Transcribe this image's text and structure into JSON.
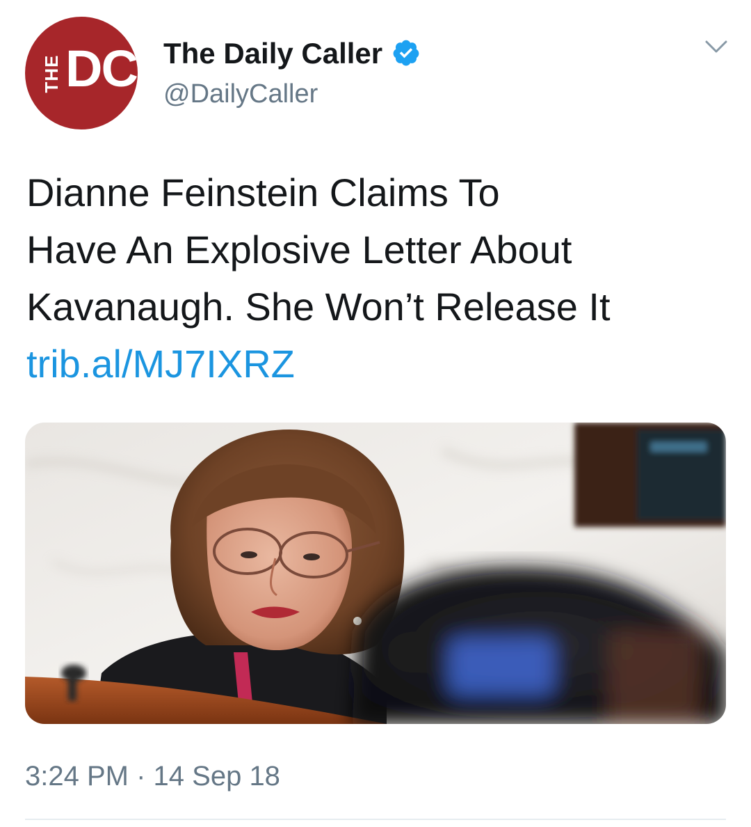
{
  "account": {
    "avatar_text_top": "THE",
    "avatar_text_main": "DC",
    "display_name": "The Daily Caller",
    "handle": "@DailyCaller",
    "verified": true,
    "verified_icon": "verified-badge-icon",
    "menu_icon": "chevron-down-icon"
  },
  "tweet": {
    "lines": [
      "Dianne Feinstein Claims To",
      "Have An Explosive Letter About",
      "Kavanaugh. She Won’t Release It"
    ],
    "link": "trib.al/MJ7IXRZ"
  },
  "media": {
    "kind": "photo"
  },
  "meta": {
    "time": "3:24 PM",
    "separator": "·",
    "date": "14 Sep 18"
  },
  "colors": {
    "avatar_bg": "#a7262a",
    "link": "#1b95e0",
    "secondary_text": "#657786",
    "verified": "#1da1f2"
  }
}
